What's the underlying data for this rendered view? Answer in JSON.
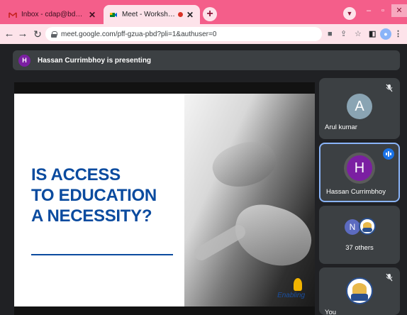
{
  "browser": {
    "tabs": [
      {
        "title": "Inbox - cdap@bdu.ac.in - Bharath",
        "icon": "gmail-icon",
        "active": false
      },
      {
        "title": "Meet - Workshop on Assistive",
        "icon": "meet-icon",
        "active": true
      }
    ],
    "new_tab": "+",
    "close_glyph": "✕",
    "url": "meet.google.com/pff-gzua-pbd?pli=1&authuser=0",
    "nav": {
      "back": "←",
      "forward": "→",
      "reload": "↻"
    },
    "window": {
      "minimize": "–",
      "maximize": "▫",
      "close": "✕"
    }
  },
  "meet": {
    "presenter_initial": "H",
    "presenting_text": "Hassan Currimbhoy is presenting",
    "slide": {
      "lines": [
        "IS ACCESS",
        "TO EDUCATION",
        "A NECESSITY?"
      ],
      "brand": "Enabling"
    },
    "participants": [
      {
        "initial": "A",
        "name": "Arul kumar",
        "muted": true
      },
      {
        "initial": "H",
        "name": "Hassan Currimbhoy",
        "speaking": true
      },
      {
        "initial": "N",
        "others_label": "37 others"
      },
      {
        "name": "You",
        "muted": true
      }
    ]
  },
  "colors": {
    "tabstrip": "#f45e8a",
    "toolbar": "#fde3ea",
    "meet_bg": "#202124",
    "tile": "#3c4043",
    "slide_text": "#0b4b9f",
    "speaking_border": "#8ab4f8"
  }
}
